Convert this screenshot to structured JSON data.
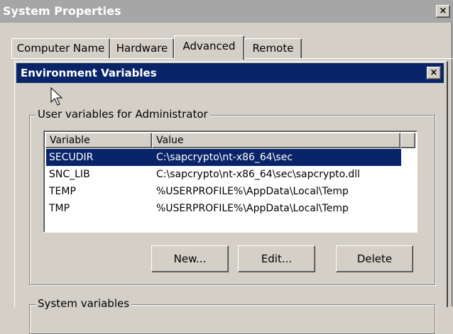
{
  "outer_window": {
    "title": "System Properties",
    "close_glyph": "×",
    "tabs": [
      {
        "label": "Computer Name",
        "active": false
      },
      {
        "label": "Hardware",
        "active": false
      },
      {
        "label": "Advanced",
        "active": true
      },
      {
        "label": "Remote",
        "active": false
      }
    ]
  },
  "dialog": {
    "title": "Environment Variables",
    "close_glyph": "×",
    "user_group": {
      "label": "User variables for Administrator",
      "columns": [
        "Variable",
        "Value"
      ],
      "rows": [
        {
          "variable": "SECUDIR",
          "value": "C:\\sapcrypto\\nt-x86_64\\sec",
          "selected": true
        },
        {
          "variable": "SNC_LIB",
          "value": "C:\\sapcrypto\\nt-x86_64\\sec\\sapcrypto.dll",
          "selected": false
        },
        {
          "variable": "TEMP",
          "value": "%USERPROFILE%\\AppData\\Local\\Temp",
          "selected": false
        },
        {
          "variable": "TMP",
          "value": "%USERPROFILE%\\AppData\\Local\\Temp",
          "selected": false
        }
      ],
      "buttons": {
        "new": "New...",
        "edit": "Edit...",
        "delete": "Delete"
      }
    },
    "system_group": {
      "label": "System variables"
    }
  },
  "icons": {
    "cursor": "arrow-cursor-icon"
  },
  "colors": {
    "selection": "#0a246a",
    "dialog_title_bar": "#0a246a",
    "inactive_title_bar": "#a6a6a6",
    "face": "#d4d0c8"
  }
}
